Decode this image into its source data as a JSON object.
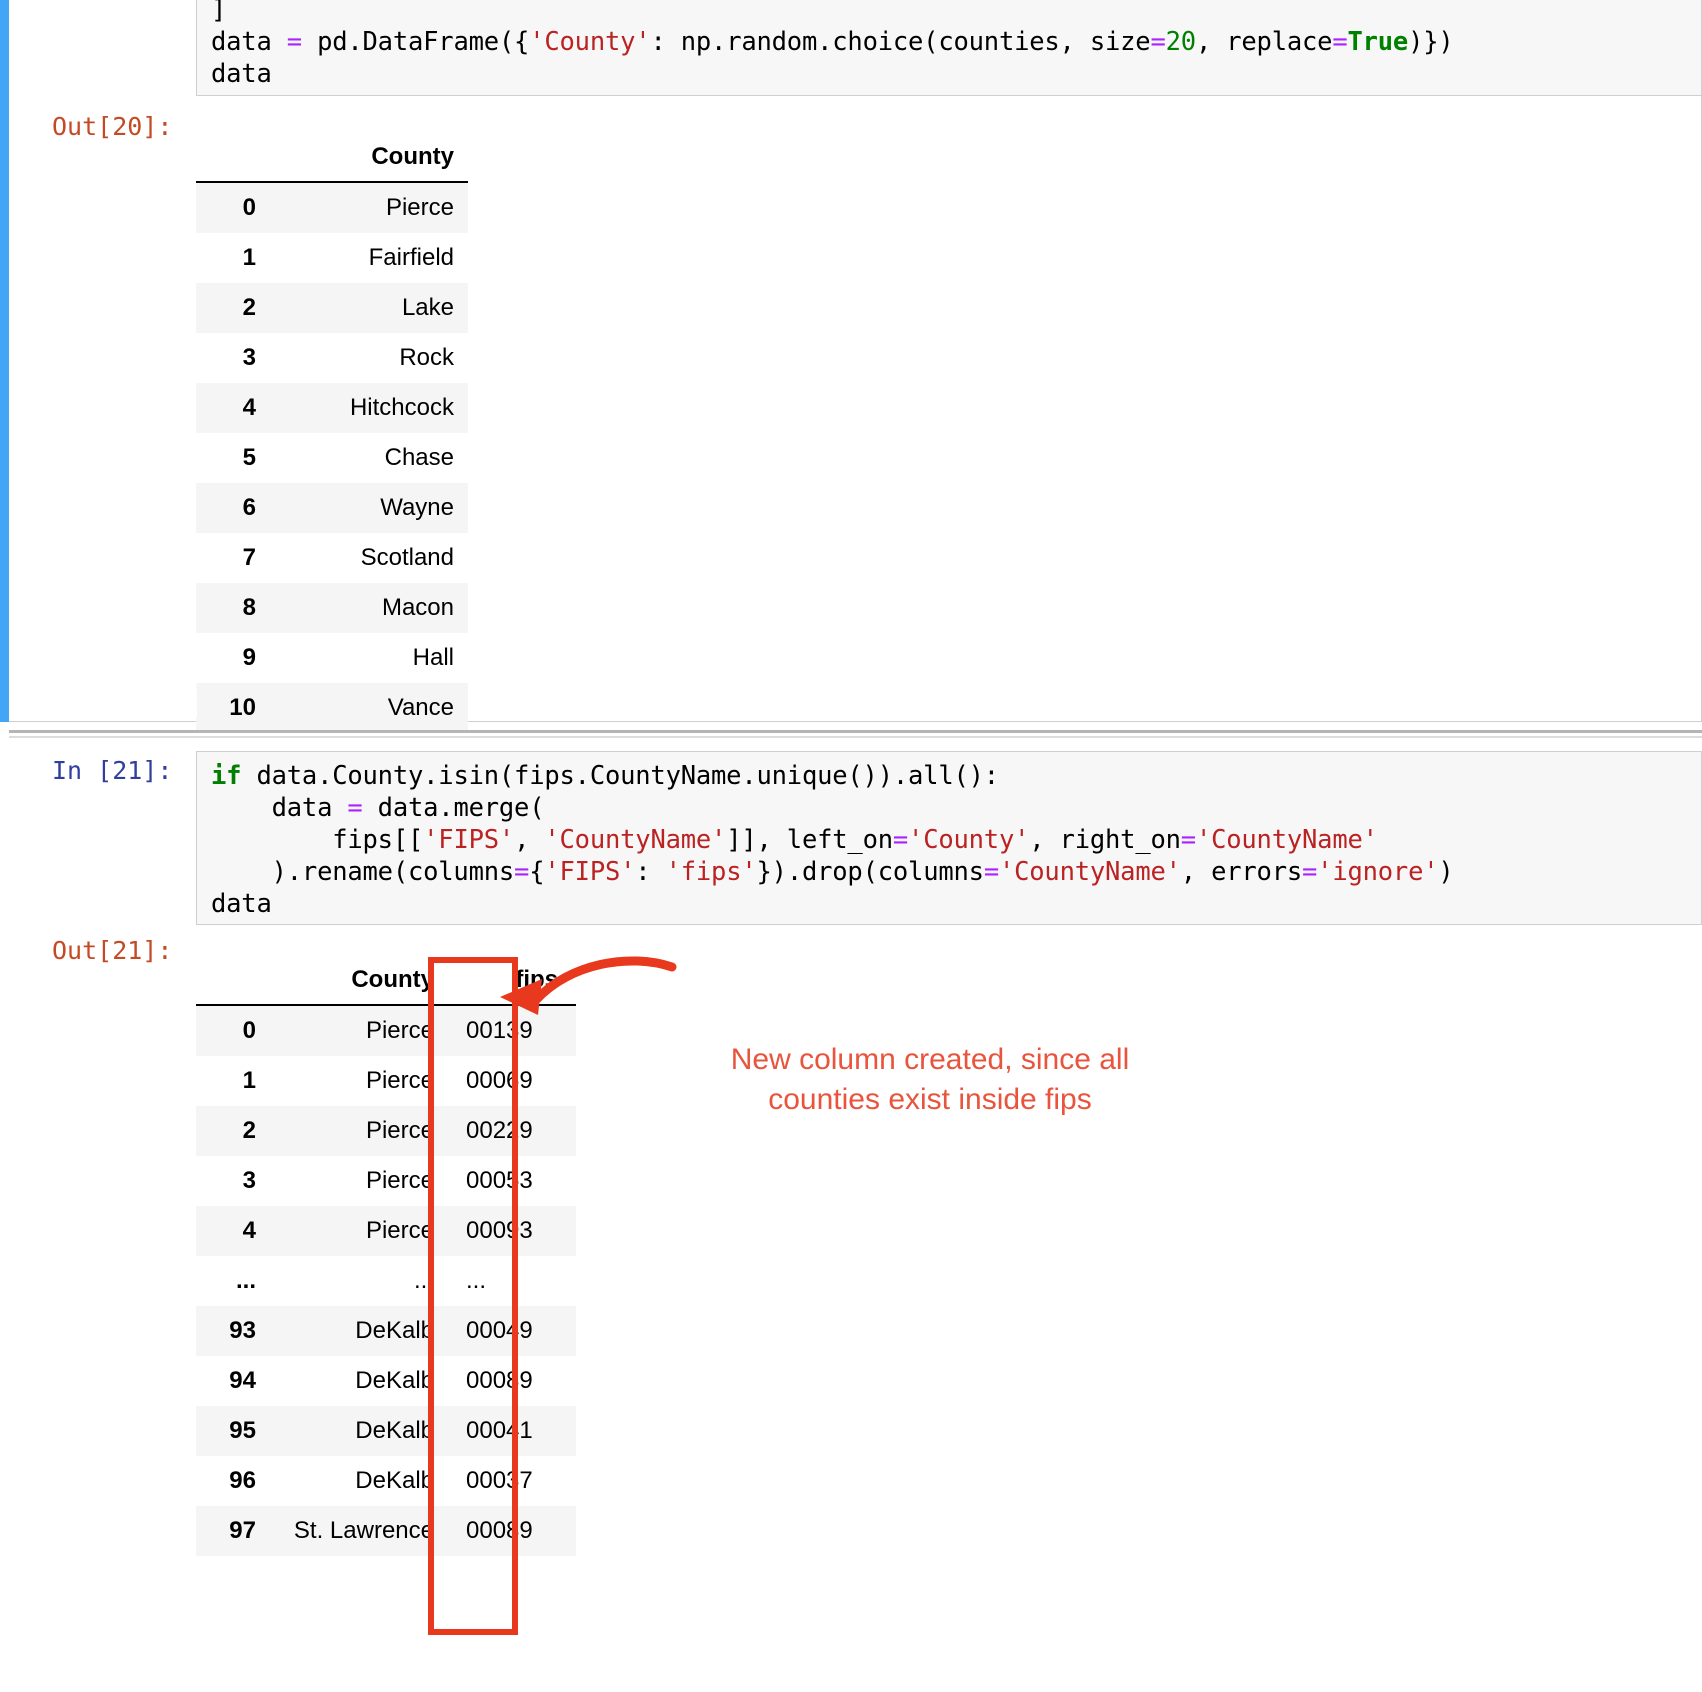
{
  "cell_in_20": {
    "code_lines": [
      "]",
      "data = pd.DataFrame({'County': np.random.choice(counties, size=20, replace=True)})",
      "data"
    ]
  },
  "out_20": {
    "prompt": "Out[20]:",
    "columns": [
      "County"
    ],
    "index_header": "",
    "rows": [
      {
        "index": "0",
        "County": "Pierce"
      },
      {
        "index": "1",
        "County": "Fairfield"
      },
      {
        "index": "2",
        "County": "Lake"
      },
      {
        "index": "3",
        "County": "Rock"
      },
      {
        "index": "4",
        "County": "Hitchcock"
      },
      {
        "index": "5",
        "County": "Chase"
      },
      {
        "index": "6",
        "County": "Wayne"
      },
      {
        "index": "7",
        "County": "Scotland"
      },
      {
        "index": "8",
        "County": "Macon"
      },
      {
        "index": "9",
        "County": "Hall"
      },
      {
        "index": "10",
        "County": "Vance"
      }
    ]
  },
  "cell_in_21": {
    "prompt": "In [21]:",
    "code_lines": [
      "if data.County.isin(fips.CountyName.unique()).all():",
      "    data = data.merge(",
      "        fips[['FIPS', 'CountyName']], left_on='County', right_on='CountyName'",
      "    ).rename(columns={'FIPS': 'fips'}).drop(columns='CountyName', errors='ignore')",
      "data"
    ]
  },
  "out_21": {
    "prompt": "Out[21]:",
    "columns": [
      "County",
      "fips"
    ],
    "rows": [
      {
        "index": "0",
        "County": "Pierce",
        "fips": "00139"
      },
      {
        "index": "1",
        "County": "Pierce",
        "fips": "00069"
      },
      {
        "index": "2",
        "County": "Pierce",
        "fips": "00229"
      },
      {
        "index": "3",
        "County": "Pierce",
        "fips": "00053"
      },
      {
        "index": "4",
        "County": "Pierce",
        "fips": "00093"
      },
      {
        "index": "...",
        "County": "...",
        "fips": "..."
      },
      {
        "index": "93",
        "County": "DeKalb",
        "fips": "00049"
      },
      {
        "index": "94",
        "County": "DeKalb",
        "fips": "00089"
      },
      {
        "index": "95",
        "County": "DeKalb",
        "fips": "00041"
      },
      {
        "index": "96",
        "County": "DeKalb",
        "fips": "00037"
      },
      {
        "index": "97",
        "County": "St. Lawrence",
        "fips": "00089"
      }
    ]
  },
  "annotation": {
    "text": "New column created, since all\ncounties exist inside fips",
    "color": "#e8543c",
    "highlight_color": "#e8381d"
  }
}
